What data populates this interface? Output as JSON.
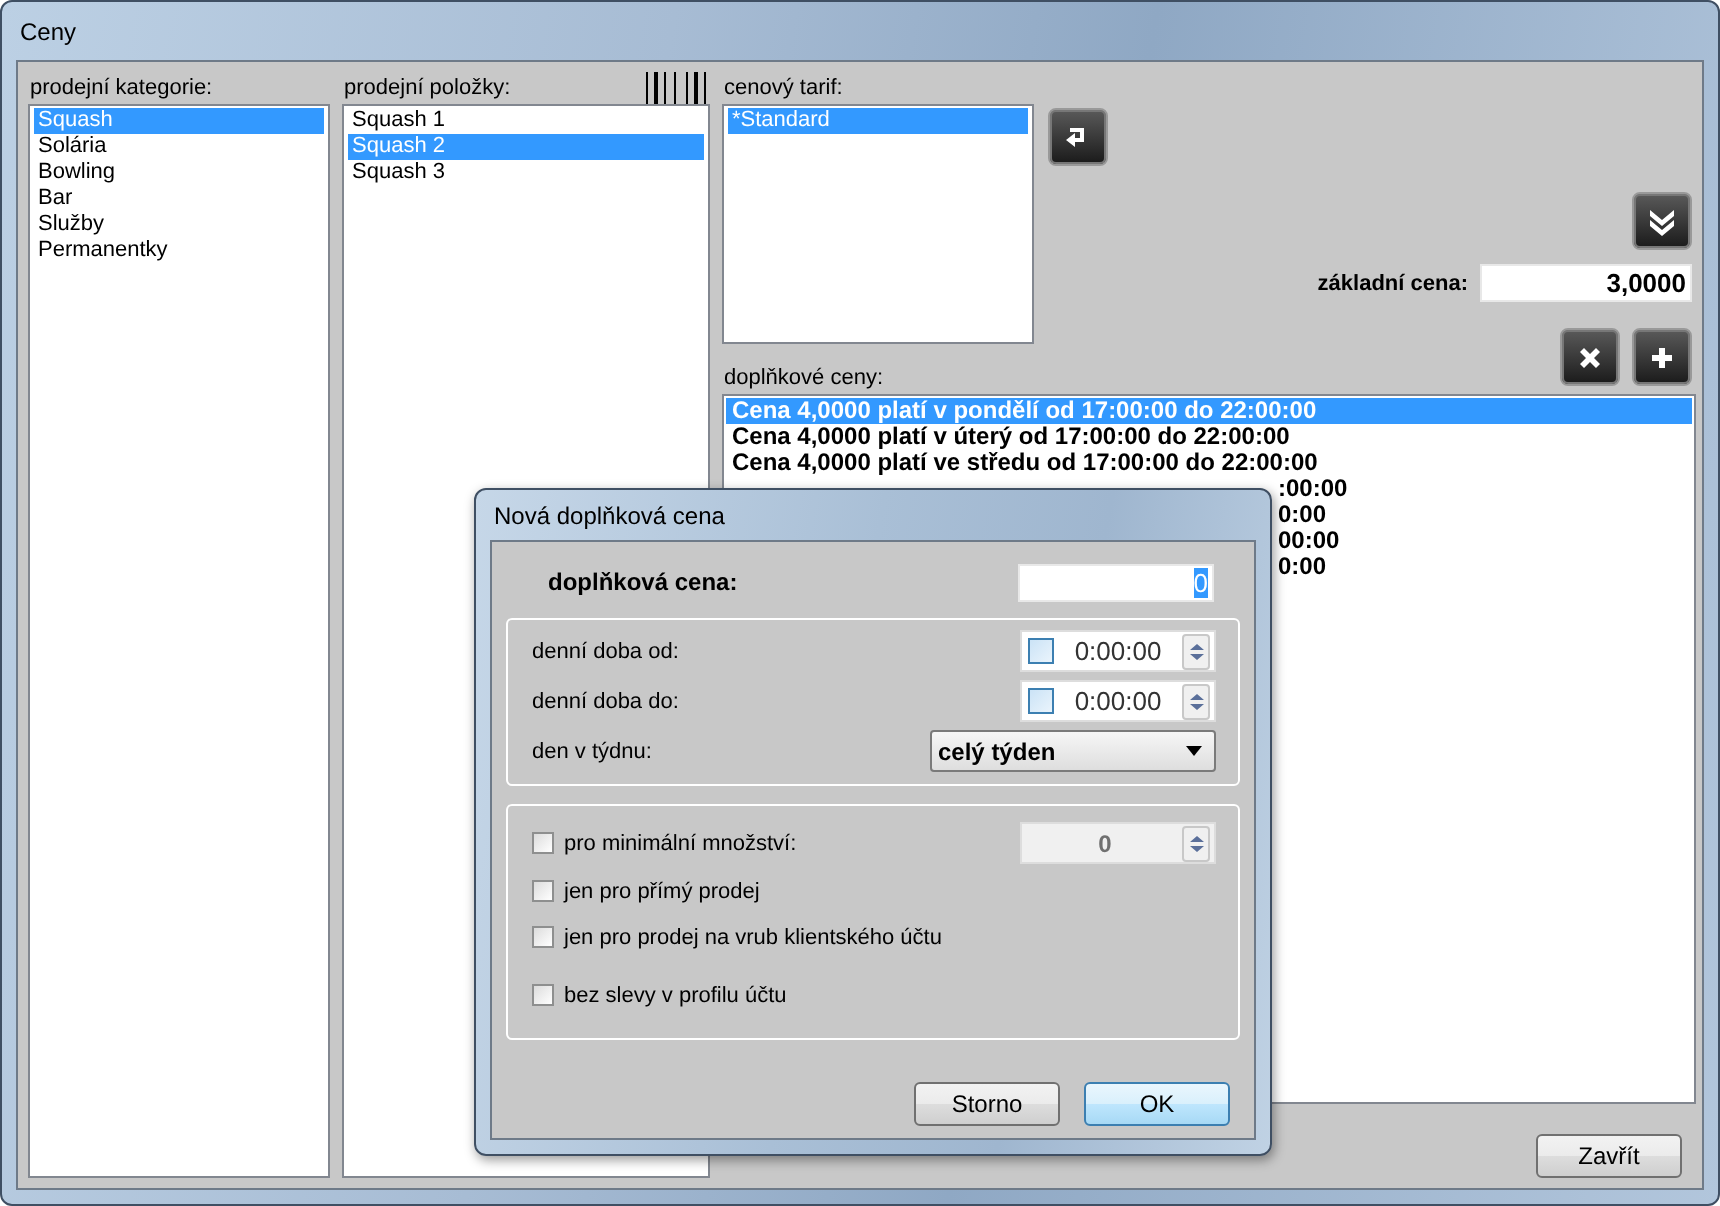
{
  "window": {
    "title": "Ceny"
  },
  "categories": {
    "label": "prodejní kategorie:",
    "items": [
      {
        "label": "Squash",
        "selected": true
      },
      {
        "label": "Solária",
        "selected": false
      },
      {
        "label": "Bowling",
        "selected": false
      },
      {
        "label": "Bar",
        "selected": false
      },
      {
        "label": "Služby",
        "selected": false
      },
      {
        "label": "Permanentky",
        "selected": false
      }
    ]
  },
  "products": {
    "label": "prodejní položky:",
    "items": [
      {
        "label": "Squash 1",
        "selected": false
      },
      {
        "label": "Squash 2",
        "selected": true
      },
      {
        "label": "Squash 3",
        "selected": false
      }
    ]
  },
  "tariff": {
    "label": "cenový tarif:",
    "items": [
      {
        "label": "*Standard",
        "selected": true
      }
    ]
  },
  "base_price": {
    "label": "základní cena:",
    "value": "3,0000"
  },
  "extra_prices": {
    "label": "doplňkové ceny:",
    "rows": [
      {
        "text": "Cena 4,0000 platí v pondělí od 17:00:00 do 22:00:00",
        "selected": true,
        "kind": "full"
      },
      {
        "text": "Cena 4,0000 platí v úterý od 17:00:00 do 22:00:00",
        "selected": false,
        "kind": "full"
      },
      {
        "text": "Cena 4,0000 platí ve středu od 17:00:00 do 22:00:00",
        "selected": false,
        "kind": "full"
      },
      {
        "text": ":00:00",
        "selected": false,
        "kind": "partial"
      },
      {
        "text": "0:00",
        "selected": false,
        "kind": "partial"
      },
      {
        "text": "00:00",
        "selected": false,
        "kind": "partial"
      },
      {
        "text": "0:00",
        "selected": false,
        "kind": "partial"
      }
    ]
  },
  "close_button": "Zavřít",
  "dialog": {
    "title": "Nová doplňková cena",
    "price": {
      "label": "doplňková cena:",
      "value": "0"
    },
    "time_from": {
      "label": "denní doba od:",
      "checked": false,
      "value": "0:00:00"
    },
    "time_to": {
      "label": "denní doba do:",
      "checked": false,
      "value": "0:00:00"
    },
    "weekday": {
      "label": "den v týdnu:",
      "value": "celý týden"
    },
    "min_qty": {
      "label": "pro minimální množství:",
      "checked": false,
      "value": "0",
      "disabled": true
    },
    "options": [
      {
        "label": "jen pro přímý prodej",
        "checked": false
      },
      {
        "label": "jen pro prodej na vrub klientského účtu",
        "checked": false
      },
      {
        "label": "bez slevy v profilu účtu",
        "checked": false
      }
    ],
    "buttons": [
      {
        "label": "Storno",
        "kind": "cancel"
      },
      {
        "label": "OK",
        "kind": "default"
      }
    ]
  }
}
